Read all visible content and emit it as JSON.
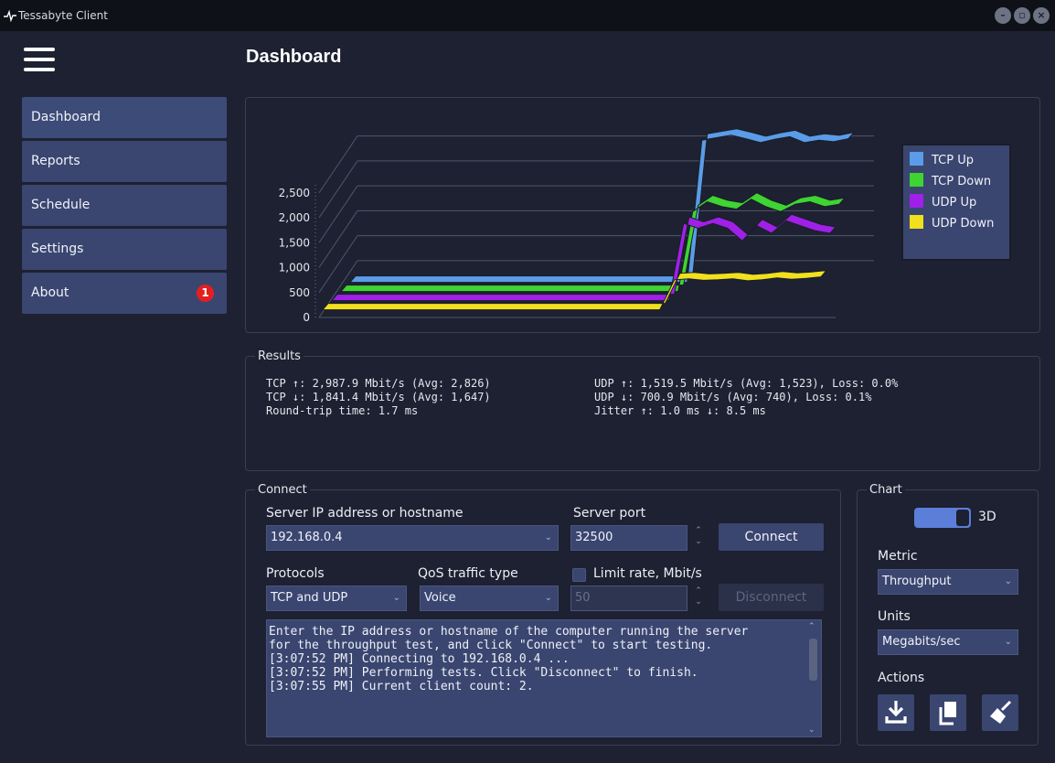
{
  "window": {
    "title": "Tessabyte Client"
  },
  "header": {
    "title": "Dashboard"
  },
  "sidebar": {
    "items": [
      {
        "label": "Dashboard"
      },
      {
        "label": "Reports"
      },
      {
        "label": "Schedule"
      },
      {
        "label": "Settings"
      },
      {
        "label": "About",
        "badge": "1"
      }
    ]
  },
  "chart_data": {
    "type": "line",
    "title": "",
    "three_d": true,
    "y_ticks": [
      "0",
      "500",
      "1,000",
      "1,500",
      "2,000",
      "2,500"
    ],
    "ylim": [
      0,
      2500
    ],
    "series": [
      {
        "name": "TCP Up",
        "color": "#5a9ce8",
        "values": [
          100,
          100,
          100,
          100,
          100,
          100,
          100,
          100,
          100,
          100,
          100,
          100,
          100,
          100,
          100,
          100,
          100,
          100,
          100,
          100,
          100,
          100,
          100,
          100,
          2950,
          3000,
          3050,
          2980,
          2900,
          2970,
          3020,
          2900,
          2950,
          2920,
          2980
        ]
      },
      {
        "name": "TCP Down",
        "color": "#3ed432",
        "values": [
          100,
          100,
          100,
          100,
          100,
          100,
          100,
          100,
          100,
          100,
          100,
          100,
          100,
          100,
          100,
          100,
          100,
          100,
          100,
          100,
          100,
          100,
          100,
          100,
          1700,
          1900,
          1800,
          1750,
          1950,
          1800,
          1700,
          1850,
          1900,
          1800,
          1850
        ]
      },
      {
        "name": "UDP Up",
        "color": "#a020e8",
        "values": [
          100,
          100,
          100,
          100,
          100,
          100,
          100,
          100,
          100,
          100,
          100,
          100,
          100,
          100,
          100,
          100,
          100,
          100,
          100,
          100,
          100,
          100,
          100,
          100,
          1650,
          1550,
          1650,
          1550,
          1300,
          1600,
          1450,
          1700,
          1600,
          1500,
          1450
        ]
      },
      {
        "name": "UDP Down",
        "color": "#f0e01e",
        "values": [
          100,
          100,
          100,
          100,
          100,
          100,
          100,
          100,
          100,
          100,
          100,
          100,
          100,
          100,
          100,
          100,
          100,
          100,
          100,
          100,
          100,
          100,
          100,
          100,
          700,
          720,
          690,
          700,
          720,
          680,
          700,
          740,
          710,
          730,
          760
        ]
      }
    ],
    "legend": "right"
  },
  "results": {
    "legend": "Results",
    "tcp_up": "TCP ↑: 2,987.9 Mbit/s (Avg: 2,826)",
    "tcp_down": "TCP ↓: 1,841.4 Mbit/s (Avg: 1,647)",
    "rtt": "Round-trip time: 1.7 ms",
    "udp_up": "UDP ↑: 1,519.5 Mbit/s (Avg: 1,523), Loss: 0.0%",
    "udp_down": "UDP ↓: 700.9 Mbit/s (Avg: 740), Loss: 0.1%",
    "jitter": "Jitter ↑: 1.0 ms ↓: 8.5 ms"
  },
  "connect": {
    "legend": "Connect",
    "server_label": "Server IP address or hostname",
    "server_value": "192.168.0.4",
    "port_label": "Server port",
    "port_value": "32500",
    "connect_button": "Connect",
    "protocols_label": "Protocols",
    "protocols_value": "TCP and UDP",
    "qos_label": "QoS traffic type",
    "qos_value": "Voice",
    "limit_label": "Limit rate, Mbit/s",
    "limit_value": "50",
    "limit_checked": false,
    "disconnect_button": "Disconnect",
    "log": [
      "Enter the IP address or hostname of the computer running the server",
      "for the throughput test, and click \"Connect\" to start testing.",
      "[3:07:52 PM] Connecting to 192.168.0.4 ...",
      "[3:07:52 PM] Performing tests. Click \"Disconnect\" to finish.",
      "[3:07:55 PM] Current client count: 2."
    ]
  },
  "chart_settings": {
    "legend": "Chart",
    "toggle_label": "3D",
    "toggle_on": true,
    "metric_label": "Metric",
    "metric_value": "Throughput",
    "units_label": "Units",
    "units_value": "Megabits/sec",
    "actions_label": "Actions",
    "actions": [
      "download-icon",
      "copy-icon",
      "clear-icon"
    ]
  }
}
